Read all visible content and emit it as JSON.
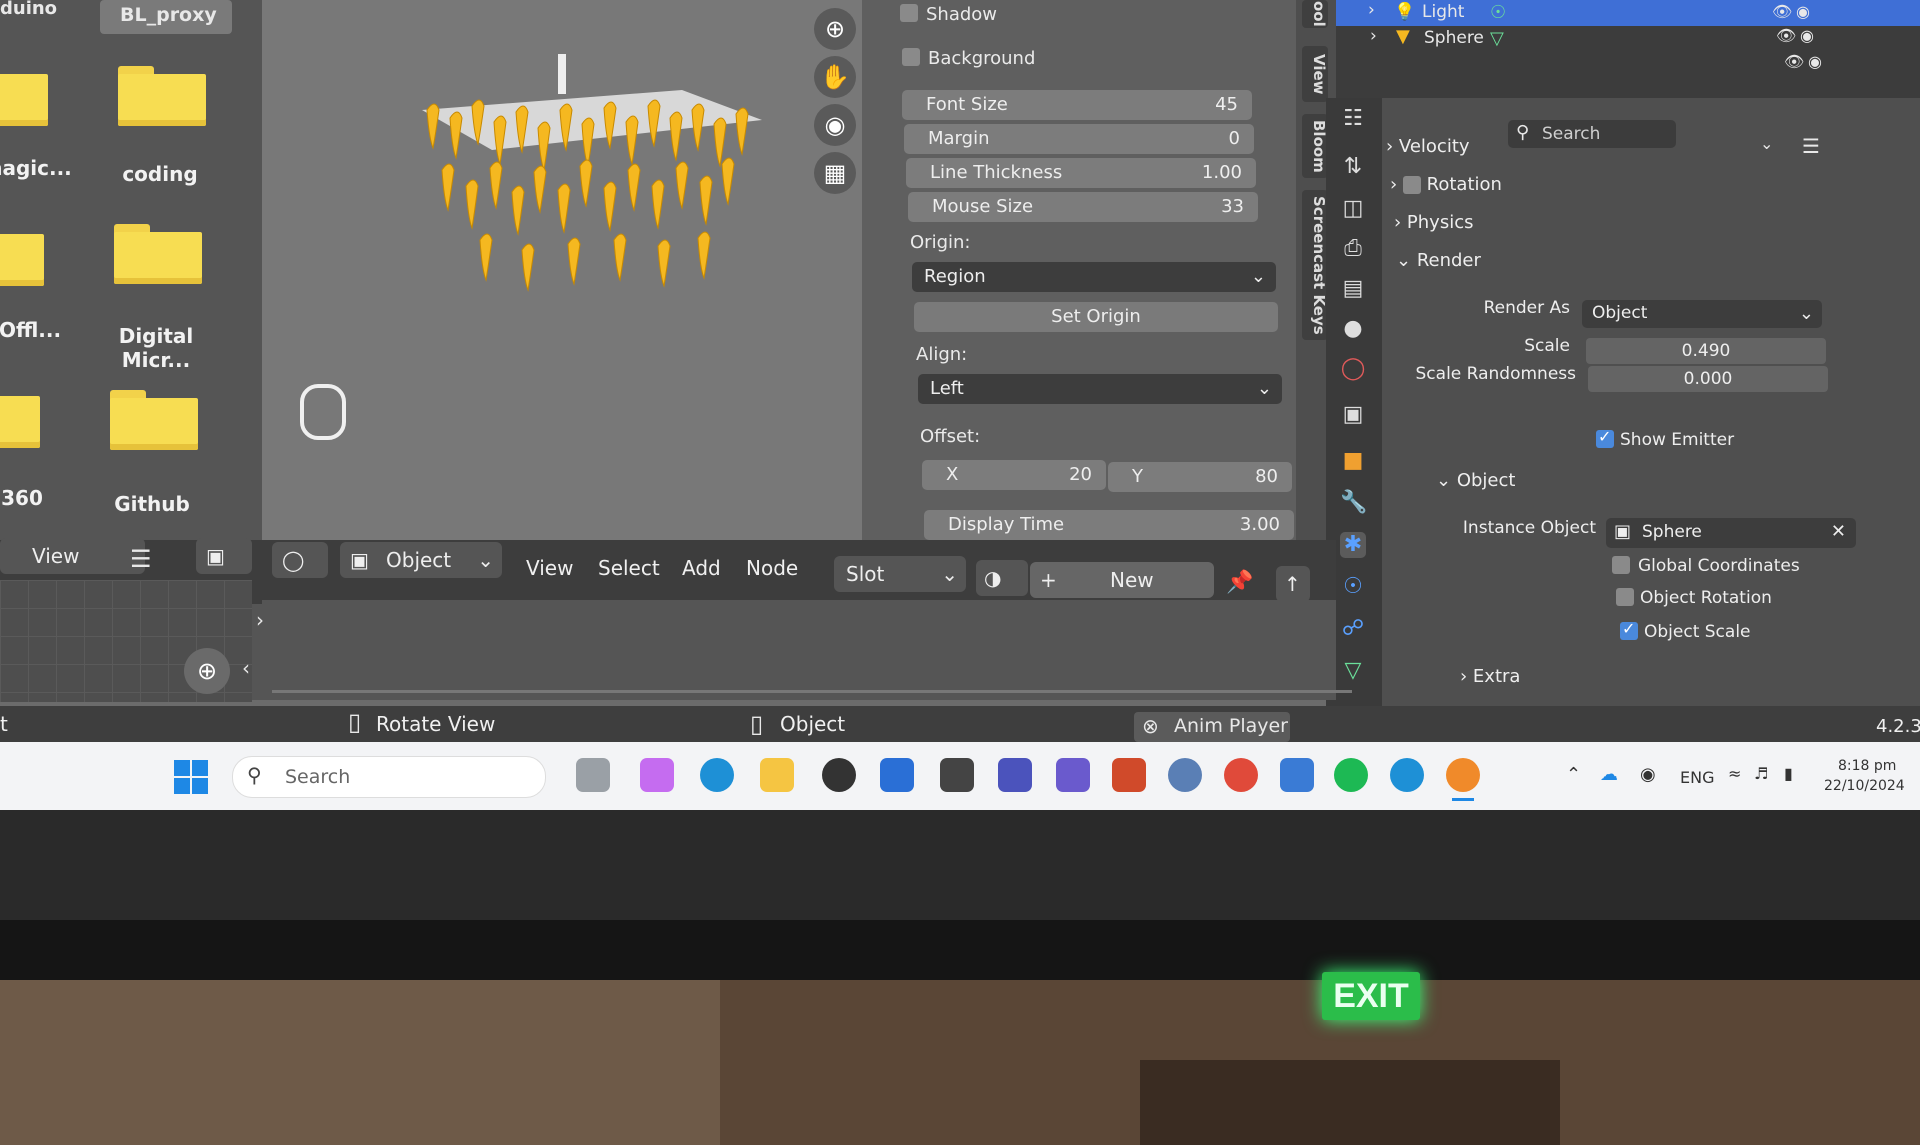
{
  "desktop": {
    "top_labels": [
      "duino",
      "BL_proxy"
    ],
    "folders": [
      "nagic...",
      "coding",
      "Offl...",
      "Digital Micr...",
      "360",
      "Github"
    ]
  },
  "viewport": {
    "tools": [
      "zoom-icon",
      "hand-icon",
      "camera-icon",
      "grid-icon"
    ]
  },
  "npanel": {
    "shadow_label": "Shadow",
    "background_label": "Background",
    "font_size": {
      "label": "Font Size",
      "value": "45"
    },
    "margin": {
      "label": "Margin",
      "value": "0"
    },
    "line_thickness": {
      "label": "Line Thickness",
      "value": "1.00"
    },
    "mouse_size": {
      "label": "Mouse Size",
      "value": "33"
    },
    "origin_label": "Origin:",
    "origin_value": "Region",
    "set_origin": "Set Origin",
    "align_label": "Align:",
    "align_value": "Left",
    "offset_label": "Offset:",
    "offset_x_label": "X",
    "offset_x": "20",
    "offset_y_label": "Y",
    "offset_y": "80",
    "display_time": {
      "label": "Display Time",
      "value": "3.00"
    }
  },
  "side_tabs": [
    "ool",
    "View",
    "Bloom",
    "Screencast Keys"
  ],
  "outliner": {
    "items": [
      {
        "label": "Light"
      },
      {
        "label": "Sphere"
      }
    ]
  },
  "properties": {
    "search_placeholder": "Search",
    "sections": {
      "velocity": "Velocity",
      "rotation": "Rotation",
      "physics": "Physics",
      "render": "Render",
      "object": "Object",
      "extra": "Extra"
    },
    "render_as": {
      "label": "Render As",
      "value": "Object"
    },
    "scale": {
      "label": "Scale",
      "value": "0.490"
    },
    "scale_randomness": {
      "label": "Scale Randomness",
      "value": "0.000"
    },
    "show_emitter": "Show Emitter",
    "instance_object": {
      "label": "Instance Object",
      "value": "Sphere"
    },
    "global_coordinates": "Global Coordinates",
    "object_rotation": "Object Rotation",
    "object_scale": "Object Scale"
  },
  "header": {
    "left_view": "View",
    "mode": "Object",
    "menus": [
      "View",
      "Select",
      "Add",
      "Node"
    ],
    "slot": "Slot",
    "new_button": "New"
  },
  "status": {
    "left": "t",
    "rotate_view": "Rotate View",
    "object": "Object",
    "anim_player": "Anim Player",
    "version": "4.2.3"
  },
  "taskbar": {
    "search_placeholder": "Search",
    "language": "ENG",
    "time": "8:18 pm",
    "date": "22/10/2024"
  },
  "room": {
    "exit_sign": "EXIT"
  },
  "colors": {
    "accent": "#4a89dc",
    "folder": "#f7dd52",
    "particles": "#f5b820"
  }
}
